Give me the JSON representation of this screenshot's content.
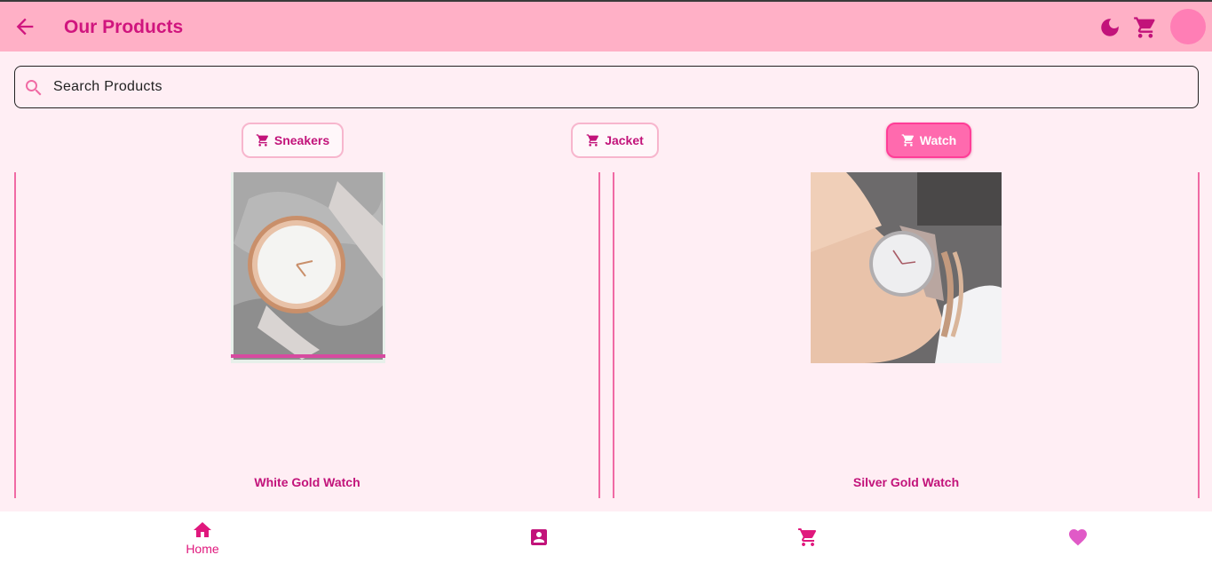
{
  "app": {
    "title": "Our Products",
    "accent_color": "#d0157e",
    "appbar_color": "#ffb0c6",
    "background_color": "#ffeef4"
  },
  "appbar": {
    "back_icon": "arrow-left-icon",
    "theme_icon": "moon-icon",
    "cart_icon": "cart-icon",
    "avatar_color": "#ff7eb5"
  },
  "search": {
    "placeholder": "Search Products",
    "value": "",
    "icon": "search-icon"
  },
  "categories": [
    {
      "label": "Sneakers",
      "icon": "cart-icon",
      "selected": false
    },
    {
      "label": "Jacket",
      "icon": "cart-icon",
      "selected": false
    },
    {
      "label": "Watch",
      "icon": "cart-icon",
      "selected": true
    }
  ],
  "products": [
    {
      "name": "White Gold Watch"
    },
    {
      "name": "Silver Gold Watch"
    }
  ],
  "bottom_nav": [
    {
      "label": "Home",
      "icon": "home-icon",
      "active": true
    },
    {
      "label": "",
      "icon": "profile-icon",
      "active": false
    },
    {
      "label": "",
      "icon": "cart-icon",
      "active": false
    },
    {
      "label": "",
      "icon": "heart-icon",
      "active": false
    }
  ]
}
